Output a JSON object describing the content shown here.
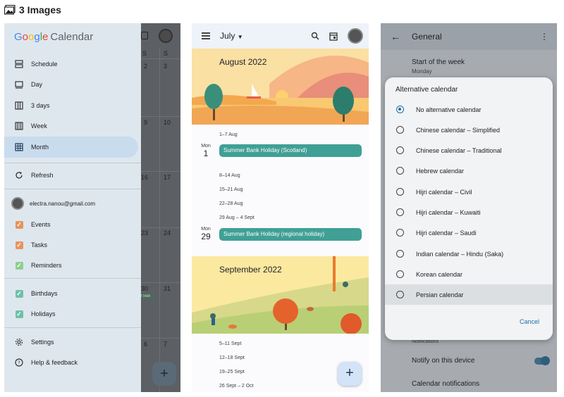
{
  "header": {
    "title": "3 Images",
    "icon": "image-gallery-icon"
  },
  "panel1": {
    "brand_google": [
      "G",
      "o",
      "o",
      "g",
      "l",
      "e"
    ],
    "brand_calendar": "Calendar",
    "views": [
      {
        "label": "Schedule",
        "icon": "schedule-icon"
      },
      {
        "label": "Day",
        "icon": "day-icon"
      },
      {
        "label": "3 days",
        "icon": "three-days-icon"
      },
      {
        "label": "Week",
        "icon": "week-icon"
      },
      {
        "label": "Month",
        "icon": "month-icon",
        "selected": true
      }
    ],
    "refresh": "Refresh",
    "account": "electra.nanou@gmail.com",
    "calendars": [
      {
        "label": "Events",
        "color": "#e8935a"
      },
      {
        "label": "Tasks",
        "color": "#e8935a"
      },
      {
        "label": "Reminders",
        "color": "#8ccf8f"
      },
      {
        "label": "Birthdays",
        "color": "#6dc1a6"
      },
      {
        "label": "Holidays",
        "color": "#6dc1a6"
      }
    ],
    "settings": "Settings",
    "help": "Help & feedback",
    "bg_weekday_row": [
      "S",
      "S"
    ],
    "bg_dates": [
      "2",
      "3",
      "9",
      "10",
      "16",
      "17",
      "23",
      "24",
      "30",
      "31",
      "6",
      "7"
    ],
    "bg_event_text": "rTeel",
    "fab": "+"
  },
  "panel2": {
    "month": "July",
    "august_title": "August 2022",
    "september_title": "September 2022",
    "weeks_aug": [
      "1–7 Aug",
      "8–14 Aug",
      "15–21 Aug",
      "22–28 Aug",
      "29 Aug – 4 Sept"
    ],
    "day1": {
      "dow": "Mon",
      "num": "1",
      "event": "Summer Bank Holiday (Scotland)"
    },
    "day29": {
      "dow": "Mon",
      "num": "29",
      "event": "Summer Bank Holiday (regional holiday)"
    },
    "weeks_sep": [
      "5–11 Sept",
      "12–18 Sept",
      "19–25 Sept",
      "26 Sept – 2 Oct"
    ],
    "fab": "+"
  },
  "panel3": {
    "title": "General",
    "start_week_label": "Start of the week",
    "start_week_value": "Monday",
    "dialog_title": "Alternative calendar",
    "options": [
      "No alternative calendar",
      "Chinese calendar – Simplified",
      "Chinese calendar – Traditional",
      "Hebrew calendar",
      "Hijri calendar – Civil",
      "Hijri calendar – Kuwaiti",
      "Hijri calendar – Saudi",
      "Indian calendar – Hindu (Saka)",
      "Korean calendar",
      "Persian calendar"
    ],
    "selected_option": 0,
    "highlighted_option": 9,
    "cancel": "Cancel",
    "notifications_header": "Notifications",
    "notify_device": "Notify on this device",
    "calendar_notifications": "Calendar notifications",
    "notify_device_on": true
  }
}
